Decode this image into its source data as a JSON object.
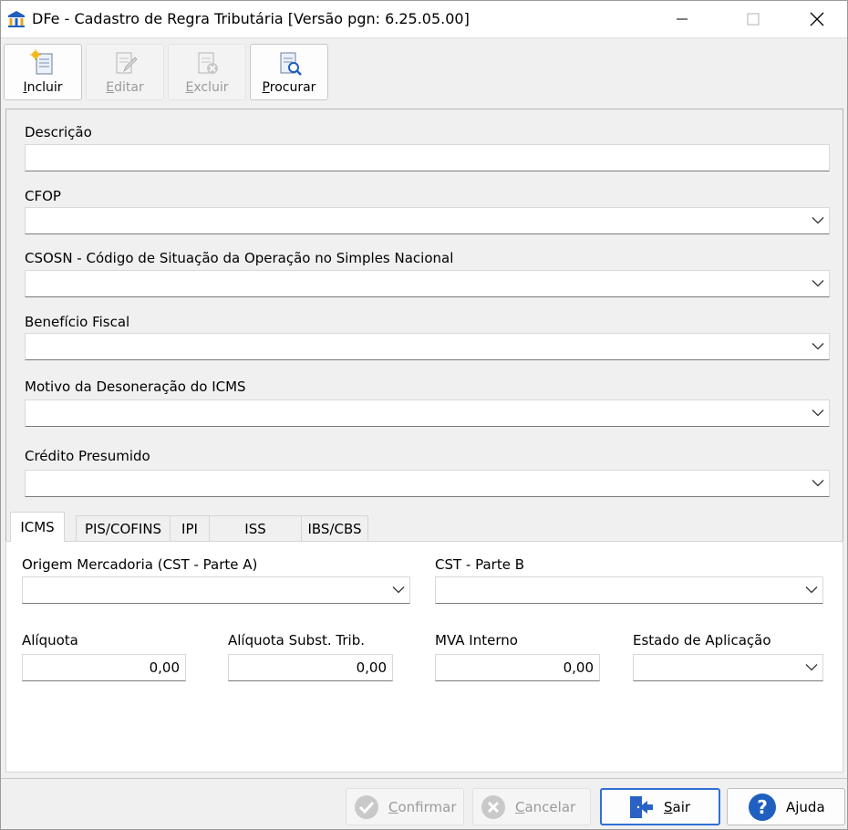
{
  "window": {
    "title": "DFe - Cadastro de Regra Tributária [Versão pgn: 6.25.05.00]",
    "accent": "#1f5fbf"
  },
  "toolbar": {
    "incluir": "Incluir",
    "editar": "Editar",
    "excluir": "Excluir",
    "procurar": "Procurar"
  },
  "form": {
    "descricao_label": "Descrição",
    "descricao_value": "",
    "cfop_label": "CFOP",
    "cfop_value": "",
    "csosn_label": "CSOSN - Código de Situação da Operação no Simples Nacional",
    "csosn_value": "",
    "beneficio_label": "Benefício Fiscal",
    "beneficio_value": "",
    "motivo_label": "Motivo da Desoneração do ICMS",
    "motivo_value": "",
    "credito_label": "Crédito Presumido",
    "credito_value": ""
  },
  "tabs": [
    {
      "label": "ICMS",
      "active": true
    },
    {
      "label": "PIS/COFINS",
      "active": false
    },
    {
      "label": "IPI",
      "active": false
    },
    {
      "label": "ISS",
      "active": false
    },
    {
      "label": "IBS/CBS",
      "active": false
    }
  ],
  "icms": {
    "origem_label": "Origem Mercadoria (CST - Parte A)",
    "origem_value": "",
    "cst_b_label": "CST - Parte B",
    "cst_b_value": "",
    "aliquota_label": "Alíquota",
    "aliquota_value": "0,00",
    "aliquota_st_label": "Alíquota Subst. Trib.",
    "aliquota_st_value": "0,00",
    "mva_label": "MVA Interno",
    "mva_value": "0,00",
    "estado_label": "Estado de Aplicação",
    "estado_value": ""
  },
  "bottom": {
    "confirmar": "Confirmar",
    "cancelar": "Cancelar",
    "sair": "Sair",
    "ajuda": "Ajuda"
  }
}
